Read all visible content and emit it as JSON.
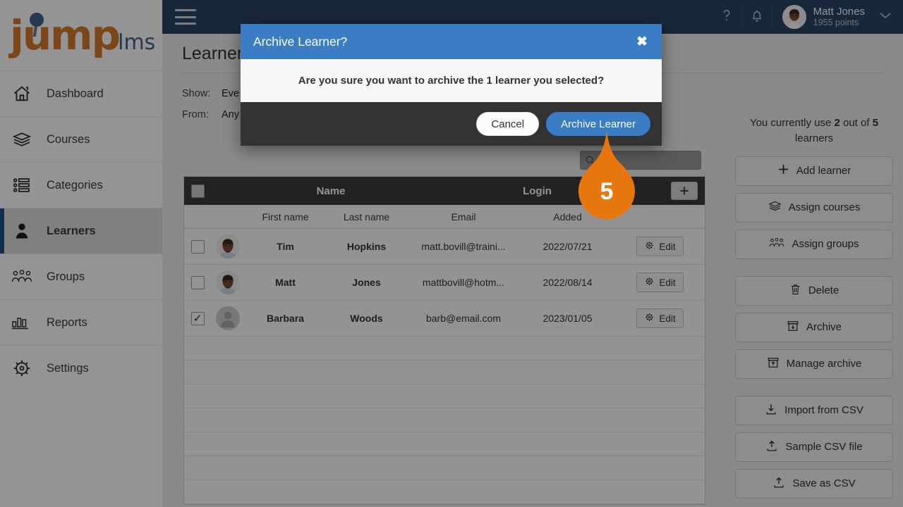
{
  "brand": {
    "name_primary": "jump",
    "name_secondary": "lms",
    "color_primary": "#d4792a",
    "color_secondary": "#41628c"
  },
  "sidebar": {
    "items": [
      {
        "label": "Dashboard",
        "icon": "home-icon",
        "active": false
      },
      {
        "label": "Courses",
        "icon": "books-icon",
        "active": false
      },
      {
        "label": "Categories",
        "icon": "list-icon",
        "active": false
      },
      {
        "label": "Learners",
        "icon": "person-icon",
        "active": true
      },
      {
        "label": "Groups",
        "icon": "people-icon",
        "active": false
      },
      {
        "label": "Reports",
        "icon": "bar-chart-icon",
        "active": false
      },
      {
        "label": "Settings",
        "icon": "gear-icon",
        "active": false
      }
    ]
  },
  "topbar": {
    "menu_icon": "hamburger-icon",
    "help_icon": "question-mark-icon",
    "bell_icon": "bell-icon",
    "user_name": "Matt Jones",
    "user_points": "1955 points",
    "caret_icon": "chevron-down-icon",
    "bg_color": "#2b4465"
  },
  "main": {
    "page_title": "Learners",
    "filters": [
      {
        "label": "Show:",
        "value": "Eve"
      },
      {
        "label": "From:",
        "value": "Any"
      }
    ],
    "search": {
      "placeholder": "",
      "value": "",
      "icon": "search-icon"
    }
  },
  "table": {
    "group_headers": {
      "name": "Name",
      "login": "Login",
      "add_icon": "plus-icon"
    },
    "columns": [
      "First name",
      "Last name",
      "Email",
      "Added"
    ],
    "select_all_checked": false,
    "rows": [
      {
        "checked": false,
        "avatar": "avatar-bearded-man",
        "first": "Tim",
        "last": "Hopkins",
        "email": "matt.bovill@traini...",
        "added": "2022/07/21",
        "edit_label": "Edit",
        "edit_icon": "gear-icon"
      },
      {
        "checked": false,
        "avatar": "avatar-bearded-man",
        "first": "Matt",
        "last": "Jones",
        "email": "mattbovill@hotm...",
        "added": "2022/08/14",
        "edit_label": "Edit",
        "edit_icon": "gear-icon"
      },
      {
        "checked": true,
        "avatar": "avatar-placeholder",
        "first": "Barbara",
        "last": "Woods",
        "email": "barb@email.com",
        "added": "2023/01/05",
        "edit_label": "Edit",
        "edit_icon": "gear-icon"
      }
    ],
    "empty_row_count": 7
  },
  "right_panel": {
    "quota_prefix": "You currently use ",
    "quota_used": "2",
    "quota_middle": " out of ",
    "quota_total": "5",
    "quota_suffix": " learners",
    "buttons": [
      {
        "label": "Add learner",
        "icon": "plus-icon"
      },
      {
        "label": "Assign courses",
        "icon": "books-icon"
      },
      {
        "label": "Assign groups",
        "icon": "people-icon"
      },
      {
        "label": "Delete",
        "icon": "trash-icon"
      },
      {
        "label": "Archive",
        "icon": "archive-down-icon"
      },
      {
        "label": "Manage archive",
        "icon": "archive-up-icon"
      },
      {
        "label": "Import from CSV",
        "icon": "download-icon"
      },
      {
        "label": "Sample CSV file",
        "icon": "upload-icon"
      },
      {
        "label": "Save as CSV",
        "icon": "upload-icon"
      }
    ]
  },
  "modal": {
    "title": "Archive Learner?",
    "close_icon": "close-icon",
    "message": "Are you sure you want to archive the 1 learner you selected?",
    "cancel_label": "Cancel",
    "confirm_label": "Archive Learner",
    "header_color": "#3b7dc4",
    "footer_color": "#333333"
  },
  "callout": {
    "number": "5",
    "color": "#e8760f"
  }
}
